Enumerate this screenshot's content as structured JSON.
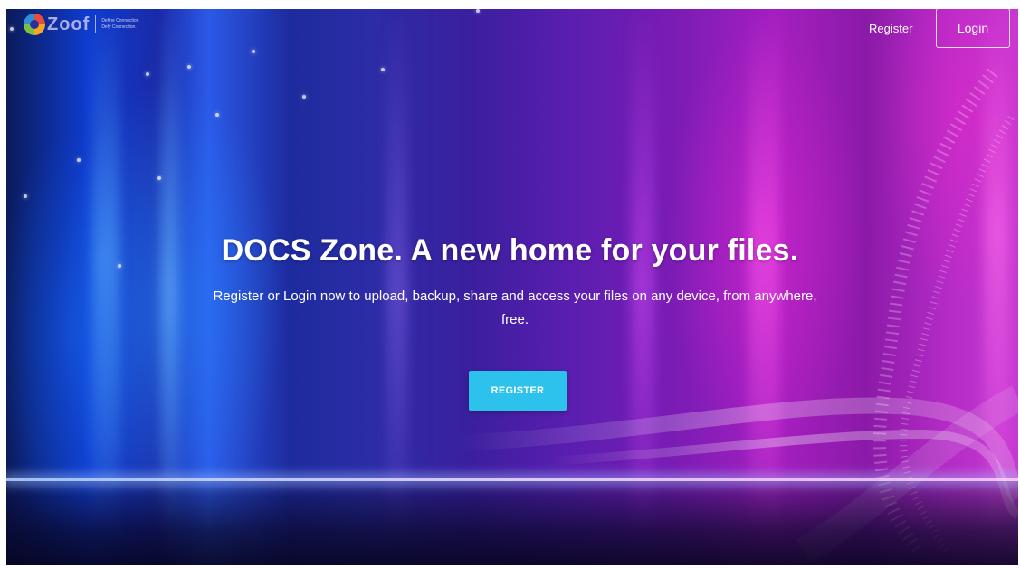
{
  "header": {
    "logo": {
      "wordmark": "Zoof",
      "tagline_line1": "Define Connection",
      "tagline_line2": "Defy Connection."
    },
    "nav": {
      "register_label": "Register",
      "login_label": "Login"
    }
  },
  "hero": {
    "headline": "DOCS Zone. A new home for your files.",
    "subtext": "Register or Login now to upload, backup, share and access your files on any device, from anywhere, free.",
    "cta_label": "REGISTER"
  },
  "colors": {
    "cta_background": "#2cc2ec",
    "text": "#ffffff"
  }
}
